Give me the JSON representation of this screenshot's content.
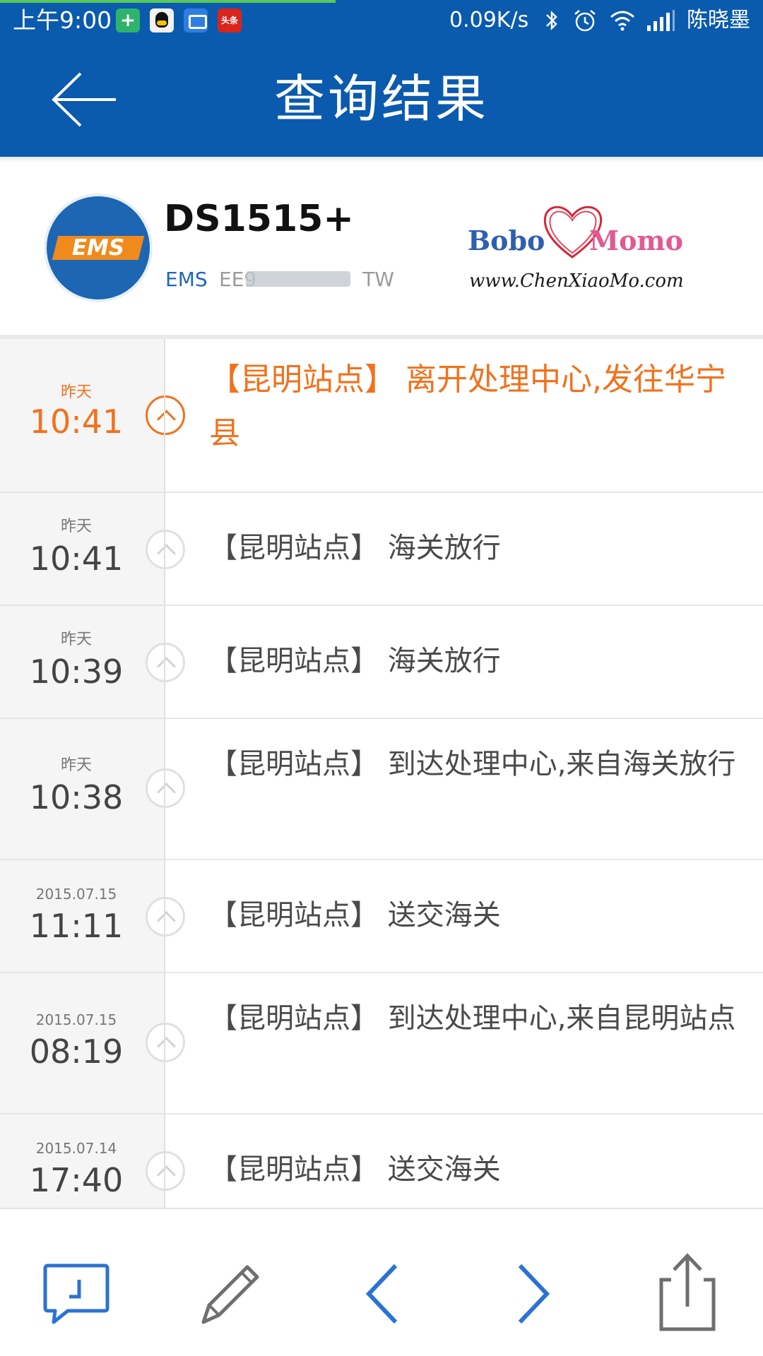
{
  "status_bar": {
    "time": "上午9:00",
    "apps": [
      {
        "name": "security-shield-icon"
      },
      {
        "name": "qq-icon"
      },
      {
        "name": "message-icon"
      },
      {
        "name": "toutiao-icon",
        "label": "头条"
      }
    ],
    "network_speed": "0.09K/s",
    "icons": [
      "bluetooth-icon",
      "alarm-icon",
      "wifi-icon",
      "signal-icon"
    ],
    "carrier": "陈晓墨"
  },
  "titlebar": {
    "title": "查询结果",
    "back_icon": "back-arrow-icon",
    "color": "#0a5aae"
  },
  "package": {
    "carrier_logo_text": "EMS",
    "name": "DS1515+",
    "carrier": "EMS",
    "tracking_prefix": "EE9",
    "tracking_suffix": "TW",
    "watermark": {
      "left": "Bobo",
      "right": "Momo",
      "url": "www.ChenXiaoMo.com"
    }
  },
  "timeline": {
    "accent_color": "#f2711c",
    "events": [
      {
        "date": "昨天",
        "time": "10:41",
        "description": "【昆明站点】 离开处理中心,发往华宁县",
        "active": true
      },
      {
        "date": "昨天",
        "time": "10:41",
        "description": "【昆明站点】 海关放行"
      },
      {
        "date": "昨天",
        "time": "10:39",
        "description": "【昆明站点】 海关放行"
      },
      {
        "date": "昨天",
        "time": "10:38",
        "description": "【昆明站点】 到达处理中心,来自海关放行"
      },
      {
        "date": "2015.07.15",
        "time": "11:11",
        "description": "【昆明站点】 送交海关"
      },
      {
        "date": "2015.07.15",
        "time": "08:19",
        "description": "【昆明站点】 到达处理中心,来自昆明站点"
      },
      {
        "date": "2015.07.14",
        "time": "17:40",
        "description": "【昆明站点】 送交海关"
      }
    ]
  },
  "toolbar": {
    "buttons": [
      "message-icon",
      "edit-pencil-icon",
      "previous-chevron-icon",
      "next-chevron-icon",
      "share-icon"
    ],
    "accent_color": "#2b73d3"
  }
}
